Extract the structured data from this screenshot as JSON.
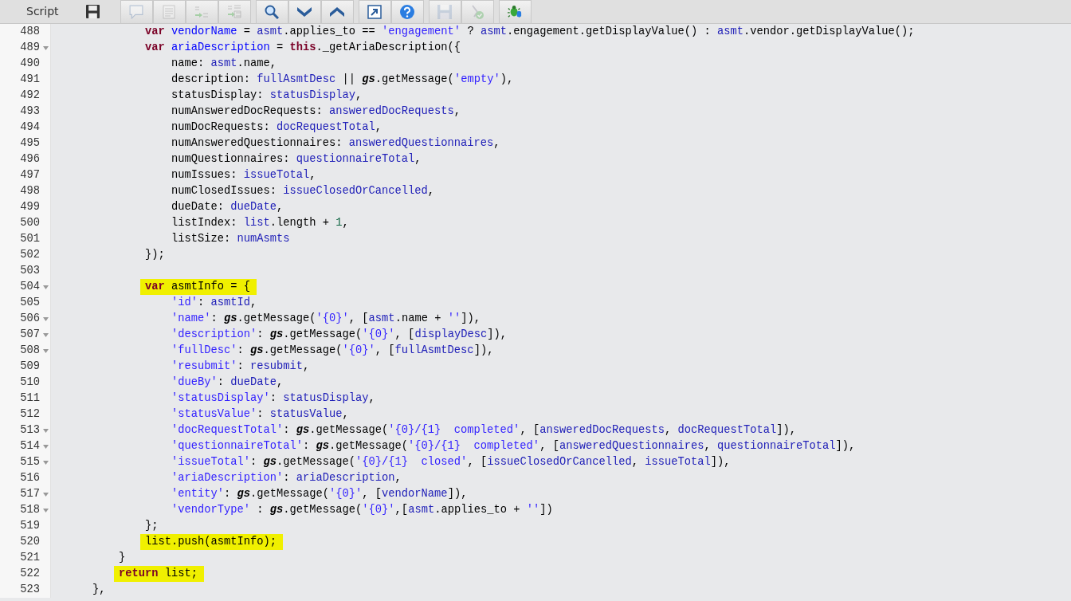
{
  "toolbar": {
    "title": "Script",
    "groups": [
      {
        "buttons": [
          {
            "kind": "comment",
            "disabled": true
          },
          {
            "kind": "format",
            "disabled": true
          },
          {
            "kind": "replace",
            "disabled": true
          },
          {
            "kind": "replace_all",
            "disabled": true
          }
        ]
      },
      {
        "buttons": [
          {
            "kind": "search",
            "disabled": false
          },
          {
            "kind": "down",
            "disabled": false
          },
          {
            "kind": "up",
            "disabled": false
          }
        ]
      },
      {
        "buttons": [
          {
            "kind": "fullscreen",
            "disabled": false
          },
          {
            "kind": "help",
            "disabled": false
          }
        ]
      },
      {
        "buttons": [
          {
            "kind": "save",
            "disabled": true
          },
          {
            "kind": "check",
            "disabled": true
          }
        ]
      },
      {
        "buttons": [
          {
            "kind": "debug",
            "disabled": false
          }
        ]
      }
    ]
  },
  "editor": {
    "lines": [
      {
        "kind": "block",
        "children": [
          {
            "kind": "block",
            "children": [
              {
                "kind": "line",
                "number": "488",
                "foldable": false,
                "highlighted": false,
                "tokens": [
                  {
                    "kind": "keyword",
                    "text": "var"
                  },
                  {
                    "kind": "def",
                    "text": " vendorName"
                  },
                  {
                    "kind": "plain",
                    "text": " = "
                  },
                  {
                    "kind": "variable",
                    "text": "asmt"
                  },
                  {
                    "kind": "plain",
                    "text": ".applies_to == "
                  },
                  {
                    "kind": "string",
                    "text": "'engagement'"
                  },
                  {
                    "kind": "plain",
                    "text": " ? "
                  },
                  {
                    "kind": "variable",
                    "text": "asmt"
                  },
                  {
                    "kind": "plain",
                    "text": ".engagement.getDisplayValue() : "
                  },
                  {
                    "kind": "variable",
                    "text": "asmt"
                  },
                  {
                    "kind": "plain",
                    "text": ".vendor.getDisplayValue();"
                  }
                ]
              },
              {
                "kind": "line",
                "number": "489",
                "foldable": true,
                "highlighted": false,
                "tokens": [
                  {
                    "kind": "keyword",
                    "text": "var"
                  },
                  {
                    "kind": "def",
                    "text": " ariaDescription"
                  },
                  {
                    "kind": "plain",
                    "text": " = "
                  },
                  {
                    "kind": "keyword",
                    "text": "this"
                  },
                  {
                    "kind": "plain",
                    "text": "._getAriaDescription({"
                  }
                ],
                "children": [
                  {
                    "kind": "line",
                    "number": "490",
                    "foldable": false,
                    "highlighted": false,
                    "tokens": [
                      {
                        "kind": "plain",
                        "text": "name: "
                      },
                      {
                        "kind": "variable",
                        "text": "asmt"
                      },
                      {
                        "kind": "plain",
                        "text": ".name,"
                      }
                    ]
                  },
                  {
                    "kind": "line",
                    "number": "491",
                    "foldable": false,
                    "highlighted": false,
                    "tokens": [
                      {
                        "kind": "plain",
                        "text": "description: "
                      },
                      {
                        "kind": "variable",
                        "text": "fullAsmtDesc"
                      },
                      {
                        "kind": "plain",
                        "text": " || "
                      },
                      {
                        "kind": "global",
                        "text": "gs"
                      },
                      {
                        "kind": "plain",
                        "text": ".getMessage("
                      },
                      {
                        "kind": "string",
                        "text": "'empty'"
                      },
                      {
                        "kind": "plain",
                        "text": "),"
                      }
                    ]
                  },
                  {
                    "kind": "line",
                    "number": "492",
                    "foldable": false,
                    "highlighted": false,
                    "tokens": [
                      {
                        "kind": "plain",
                        "text": "statusDisplay: "
                      },
                      {
                        "kind": "variable",
                        "text": "statusDisplay"
                      },
                      {
                        "kind": "plain",
                        "text": ","
                      }
                    ]
                  },
                  {
                    "kind": "line",
                    "number": "493",
                    "foldable": false,
                    "highlighted": false,
                    "tokens": [
                      {
                        "kind": "plain",
                        "text": "numAnsweredDocRequests: "
                      },
                      {
                        "kind": "variable",
                        "text": "answeredDocRequests"
                      },
                      {
                        "kind": "plain",
                        "text": ","
                      }
                    ]
                  },
                  {
                    "kind": "line",
                    "number": "494",
                    "foldable": false,
                    "highlighted": false,
                    "tokens": [
                      {
                        "kind": "plain",
                        "text": "numDocRequests: "
                      },
                      {
                        "kind": "variable",
                        "text": "docRequestTotal"
                      },
                      {
                        "kind": "plain",
                        "text": ","
                      }
                    ]
                  },
                  {
                    "kind": "line",
                    "number": "495",
                    "foldable": false,
                    "highlighted": false,
                    "tokens": [
                      {
                        "kind": "plain",
                        "text": "numAnsweredQuestionnaires: "
                      },
                      {
                        "kind": "variable",
                        "text": "answeredQuestionnaires"
                      },
                      {
                        "kind": "plain",
                        "text": ","
                      }
                    ]
                  },
                  {
                    "kind": "line",
                    "number": "496",
                    "foldable": false,
                    "highlighted": false,
                    "tokens": [
                      {
                        "kind": "plain",
                        "text": "numQuestionnaires: "
                      },
                      {
                        "kind": "variable",
                        "text": "questionnaireTotal"
                      },
                      {
                        "kind": "plain",
                        "text": ","
                      }
                    ]
                  },
                  {
                    "kind": "line",
                    "number": "497",
                    "foldable": false,
                    "highlighted": false,
                    "tokens": [
                      {
                        "kind": "plain",
                        "text": "numIssues: "
                      },
                      {
                        "kind": "variable",
                        "text": "issueTotal"
                      },
                      {
                        "kind": "plain",
                        "text": ","
                      }
                    ]
                  },
                  {
                    "kind": "line",
                    "number": "498",
                    "foldable": false,
                    "highlighted": false,
                    "tokens": [
                      {
                        "kind": "plain",
                        "text": "numClosedIssues: "
                      },
                      {
                        "kind": "variable",
                        "text": "issueClosedOrCancelled"
                      },
                      {
                        "kind": "plain",
                        "text": ","
                      }
                    ]
                  },
                  {
                    "kind": "line",
                    "number": "499",
                    "foldable": false,
                    "highlighted": false,
                    "tokens": [
                      {
                        "kind": "plain",
                        "text": "dueDate: "
                      },
                      {
                        "kind": "variable",
                        "text": "dueDate"
                      },
                      {
                        "kind": "plain",
                        "text": ","
                      }
                    ]
                  },
                  {
                    "kind": "line",
                    "number": "500",
                    "foldable": false,
                    "highlighted": false,
                    "tokens": [
                      {
                        "kind": "plain",
                        "text": "listIndex: "
                      },
                      {
                        "kind": "variable",
                        "text": "list"
                      },
                      {
                        "kind": "plain",
                        "text": ".length + "
                      },
                      {
                        "kind": "number",
                        "text": "1"
                      },
                      {
                        "kind": "plain",
                        "text": ","
                      }
                    ]
                  },
                  {
                    "kind": "line",
                    "number": "501",
                    "foldable": false,
                    "highlighted": false,
                    "tokens": [
                      {
                        "kind": "plain",
                        "text": "listSize: "
                      },
                      {
                        "kind": "variable",
                        "text": "numAsmts"
                      }
                    ]
                  }
                ]
              },
              {
                "kind": "line",
                "number": "502",
                "foldable": false,
                "highlighted": false,
                "tokens": [
                  {
                    "kind": "plain",
                    "text": "});"
                  }
                ]
              },
              {
                "kind": "line",
                "number": "503",
                "foldable": false,
                "highlighted": false
              },
              {
                "kind": "line",
                "number": "504",
                "foldable": true,
                "highlighted": true,
                "tokens": [
                  {
                    "kind": "keyword",
                    "text": "var"
                  },
                  {
                    "kind": "plain",
                    "text": " asmtInfo = {"
                  }
                ],
                "children": [
                  {
                    "kind": "line",
                    "number": "505",
                    "foldable": false,
                    "highlighted": false,
                    "tokens": [
                      {
                        "kind": "string",
                        "text": "'id'"
                      },
                      {
                        "kind": "plain",
                        "text": ": "
                      },
                      {
                        "kind": "variable",
                        "text": "asmtId"
                      },
                      {
                        "kind": "plain",
                        "text": ","
                      }
                    ]
                  },
                  {
                    "kind": "line",
                    "number": "506",
                    "foldable": true,
                    "highlighted": false,
                    "tokens": [
                      {
                        "kind": "string",
                        "text": "'name'"
                      },
                      {
                        "kind": "plain",
                        "text": ": "
                      },
                      {
                        "kind": "global",
                        "text": "gs"
                      },
                      {
                        "kind": "plain",
                        "text": ".getMessage("
                      },
                      {
                        "kind": "string",
                        "text": "'{0}'"
                      },
                      {
                        "kind": "plain",
                        "text": ", ["
                      },
                      {
                        "kind": "variable",
                        "text": "asmt"
                      },
                      {
                        "kind": "plain",
                        "text": ".name + "
                      },
                      {
                        "kind": "string",
                        "text": "''"
                      },
                      {
                        "kind": "plain",
                        "text": "]),"
                      }
                    ]
                  },
                  {
                    "kind": "line",
                    "number": "507",
                    "foldable": true,
                    "highlighted": false,
                    "tokens": [
                      {
                        "kind": "string",
                        "text": "'description'"
                      },
                      {
                        "kind": "plain",
                        "text": ": "
                      },
                      {
                        "kind": "global",
                        "text": "gs"
                      },
                      {
                        "kind": "plain",
                        "text": ".getMessage("
                      },
                      {
                        "kind": "string",
                        "text": "'{0}'"
                      },
                      {
                        "kind": "plain",
                        "text": ", ["
                      },
                      {
                        "kind": "variable",
                        "text": "displayDesc"
                      },
                      {
                        "kind": "plain",
                        "text": "]),"
                      }
                    ]
                  },
                  {
                    "kind": "line",
                    "number": "508",
                    "foldable": true,
                    "highlighted": false,
                    "tokens": [
                      {
                        "kind": "string",
                        "text": "'fullDesc'"
                      },
                      {
                        "kind": "plain",
                        "text": ": "
                      },
                      {
                        "kind": "global",
                        "text": "gs"
                      },
                      {
                        "kind": "plain",
                        "text": ".getMessage("
                      },
                      {
                        "kind": "string",
                        "text": "'{0}'"
                      },
                      {
                        "kind": "plain",
                        "text": ", ["
                      },
                      {
                        "kind": "variable",
                        "text": "fullAsmtDesc"
                      },
                      {
                        "kind": "plain",
                        "text": "]),"
                      }
                    ]
                  },
                  {
                    "kind": "line",
                    "number": "509",
                    "foldable": false,
                    "highlighted": false,
                    "tokens": [
                      {
                        "kind": "string",
                        "text": "'resubmit'"
                      },
                      {
                        "kind": "plain",
                        "text": ": "
                      },
                      {
                        "kind": "variable",
                        "text": "resubmit"
                      },
                      {
                        "kind": "plain",
                        "text": ","
                      }
                    ]
                  },
                  {
                    "kind": "line",
                    "number": "510",
                    "foldable": false,
                    "highlighted": false,
                    "tokens": [
                      {
                        "kind": "string",
                        "text": "'dueBy'"
                      },
                      {
                        "kind": "plain",
                        "text": ": "
                      },
                      {
                        "kind": "variable",
                        "text": "dueDate"
                      },
                      {
                        "kind": "plain",
                        "text": ","
                      }
                    ]
                  },
                  {
                    "kind": "line",
                    "number": "511",
                    "foldable": false,
                    "highlighted": false,
                    "tokens": [
                      {
                        "kind": "string",
                        "text": "'statusDisplay'"
                      },
                      {
                        "kind": "plain",
                        "text": ": "
                      },
                      {
                        "kind": "variable",
                        "text": "statusDisplay"
                      },
                      {
                        "kind": "plain",
                        "text": ","
                      }
                    ]
                  },
                  {
                    "kind": "line",
                    "number": "512",
                    "foldable": false,
                    "highlighted": false,
                    "tokens": [
                      {
                        "kind": "string",
                        "text": "'statusValue'"
                      },
                      {
                        "kind": "plain",
                        "text": ": "
                      },
                      {
                        "kind": "variable",
                        "text": "statusValue"
                      },
                      {
                        "kind": "plain",
                        "text": ","
                      }
                    ]
                  },
                  {
                    "kind": "line",
                    "number": "513",
                    "foldable": true,
                    "highlighted": false,
                    "tokens": [
                      {
                        "kind": "string",
                        "text": "'docRequestTotal'"
                      },
                      {
                        "kind": "plain",
                        "text": ": "
                      },
                      {
                        "kind": "global",
                        "text": "gs"
                      },
                      {
                        "kind": "plain",
                        "text": ".getMessage("
                      },
                      {
                        "kind": "string",
                        "text": "'{0}/{1}  completed'"
                      },
                      {
                        "kind": "plain",
                        "text": ", ["
                      },
                      {
                        "kind": "variable",
                        "text": "answeredDocRequests"
                      },
                      {
                        "kind": "plain",
                        "text": ", "
                      },
                      {
                        "kind": "variable",
                        "text": "docRequestTotal"
                      },
                      {
                        "kind": "plain",
                        "text": "]),"
                      }
                    ]
                  },
                  {
                    "kind": "line",
                    "number": "514",
                    "foldable": true,
                    "highlighted": false,
                    "tokens": [
                      {
                        "kind": "string",
                        "text": "'questionnaireTotal'"
                      },
                      {
                        "kind": "plain",
                        "text": ": "
                      },
                      {
                        "kind": "global",
                        "text": "gs"
                      },
                      {
                        "kind": "plain",
                        "text": ".getMessage("
                      },
                      {
                        "kind": "string",
                        "text": "'{0}/{1}  completed'"
                      },
                      {
                        "kind": "plain",
                        "text": ", ["
                      },
                      {
                        "kind": "variable",
                        "text": "answeredQuestionnaires"
                      },
                      {
                        "kind": "plain",
                        "text": ", "
                      },
                      {
                        "kind": "variable",
                        "text": "questionnaireTotal"
                      },
                      {
                        "kind": "plain",
                        "text": "]),"
                      }
                    ]
                  },
                  {
                    "kind": "line",
                    "number": "515",
                    "foldable": true,
                    "highlighted": false,
                    "tokens": [
                      {
                        "kind": "string",
                        "text": "'issueTotal'"
                      },
                      {
                        "kind": "plain",
                        "text": ": "
                      },
                      {
                        "kind": "global",
                        "text": "gs"
                      },
                      {
                        "kind": "plain",
                        "text": ".getMessage("
                      },
                      {
                        "kind": "string",
                        "text": "'{0}/{1}  closed'"
                      },
                      {
                        "kind": "plain",
                        "text": ", ["
                      },
                      {
                        "kind": "variable",
                        "text": "issueClosedOrCancelled"
                      },
                      {
                        "kind": "plain",
                        "text": ", "
                      },
                      {
                        "kind": "variable",
                        "text": "issueTotal"
                      },
                      {
                        "kind": "plain",
                        "text": "]),"
                      }
                    ]
                  },
                  {
                    "kind": "line",
                    "number": "516",
                    "foldable": false,
                    "highlighted": false,
                    "tokens": [
                      {
                        "kind": "string",
                        "text": "'ariaDescription'"
                      },
                      {
                        "kind": "plain",
                        "text": ": "
                      },
                      {
                        "kind": "variable",
                        "text": "ariaDescription"
                      },
                      {
                        "kind": "plain",
                        "text": ","
                      }
                    ]
                  },
                  {
                    "kind": "line",
                    "number": "517",
                    "foldable": true,
                    "highlighted": false,
                    "tokens": [
                      {
                        "kind": "string",
                        "text": "'entity'"
                      },
                      {
                        "kind": "plain",
                        "text": ": "
                      },
                      {
                        "kind": "global",
                        "text": "gs"
                      },
                      {
                        "kind": "plain",
                        "text": ".getMessage("
                      },
                      {
                        "kind": "string",
                        "text": "'{0}'"
                      },
                      {
                        "kind": "plain",
                        "text": ", ["
                      },
                      {
                        "kind": "variable",
                        "text": "vendorName"
                      },
                      {
                        "kind": "plain",
                        "text": "]),"
                      }
                    ]
                  },
                  {
                    "kind": "line",
                    "number": "518",
                    "foldable": true,
                    "highlighted": false,
                    "tokens": [
                      {
                        "kind": "string",
                        "text": "'vendorType'"
                      },
                      {
                        "kind": "plain",
                        "text": " : "
                      },
                      {
                        "kind": "global",
                        "text": "gs"
                      },
                      {
                        "kind": "plain",
                        "text": ".getMessage("
                      },
                      {
                        "kind": "string",
                        "text": "'{0}'"
                      },
                      {
                        "kind": "plain",
                        "text": ",["
                      },
                      {
                        "kind": "variable",
                        "text": "asmt"
                      },
                      {
                        "kind": "plain",
                        "text": ".applies_to + "
                      },
                      {
                        "kind": "string",
                        "text": "''"
                      },
                      {
                        "kind": "plain",
                        "text": "])"
                      }
                    ]
                  }
                ]
              },
              {
                "kind": "line",
                "number": "519",
                "foldable": false,
                "highlighted": false,
                "tokens": [
                  {
                    "kind": "plain",
                    "text": "};"
                  }
                ]
              },
              {
                "kind": "line",
                "number": "520",
                "foldable": false,
                "highlighted": true,
                "tokens": [
                  {
                    "kind": "plain",
                    "text": "list.push(asmtInfo);"
                  }
                ]
              }
            ]
          },
          {
            "kind": "line",
            "number": "521",
            "foldable": false,
            "highlighted": false,
            "tokens": [
              {
                "kind": "plain",
                "text": "}"
              }
            ]
          },
          {
            "kind": "line",
            "number": "522",
            "foldable": false,
            "highlighted": true,
            "tokens": [
              {
                "kind": "keyword",
                "text": "return"
              },
              {
                "kind": "plain",
                "text": " list;"
              }
            ]
          }
        ]
      },
      {
        "kind": "line",
        "number": "523",
        "foldable": false,
        "highlighted": false,
        "tokens": [
          {
            "kind": "plain",
            "text": "},"
          }
        ]
      }
    ]
  }
}
